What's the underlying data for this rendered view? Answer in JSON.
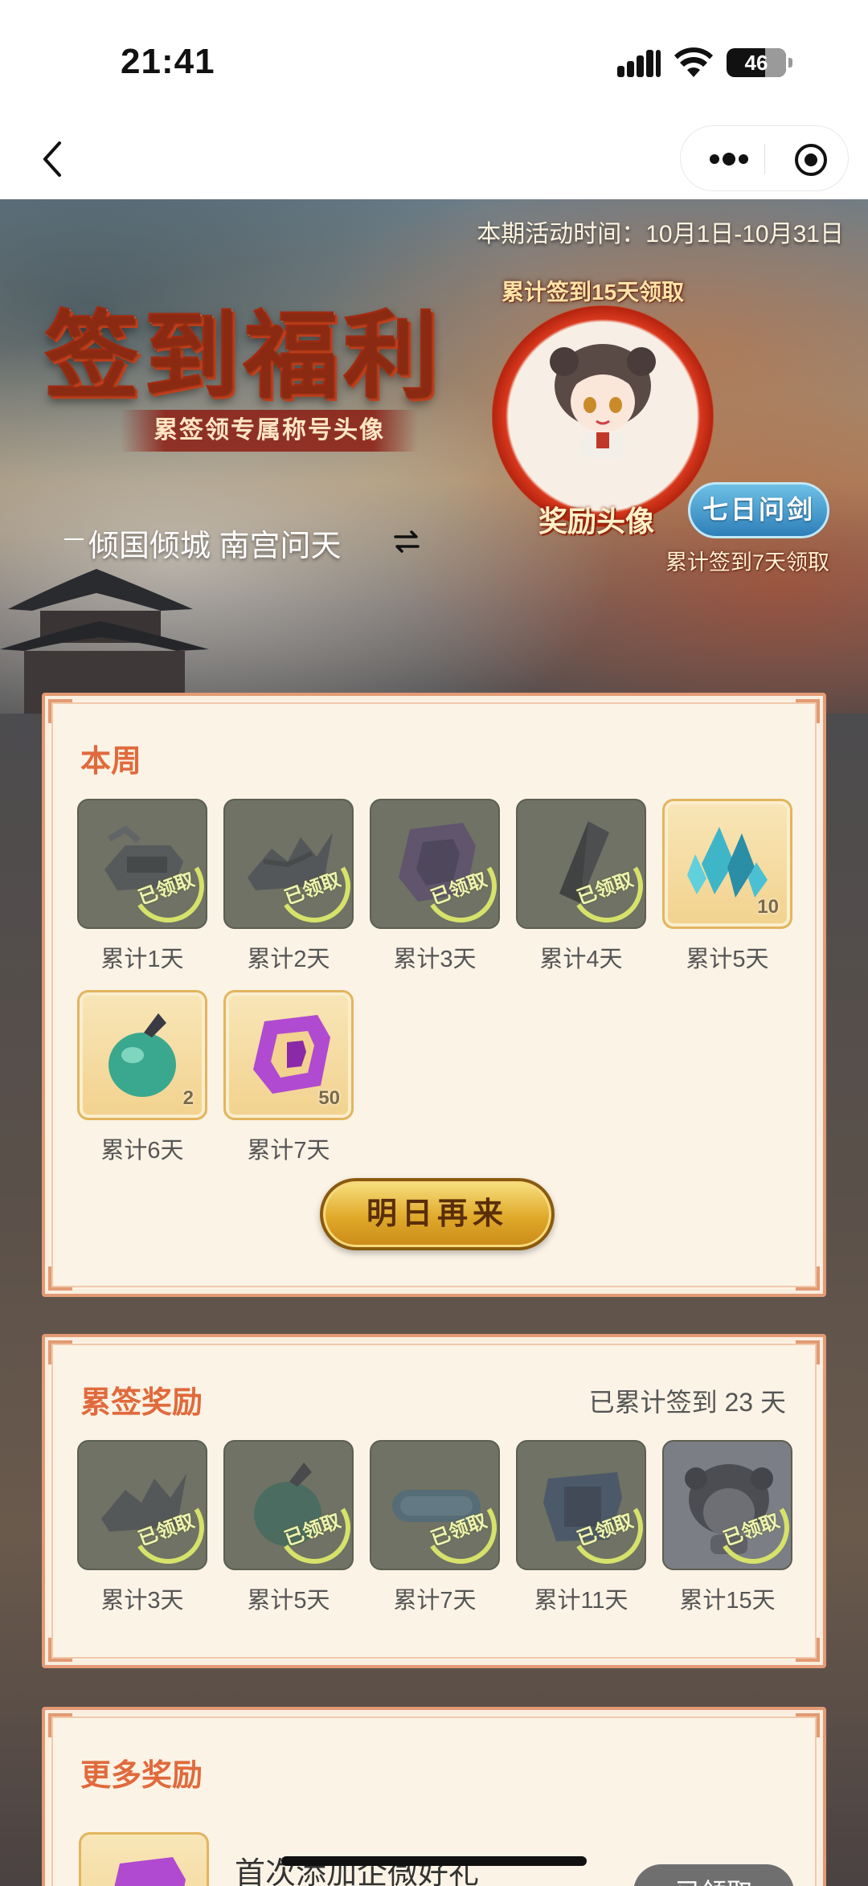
{
  "status_bar": {
    "time": "21:41",
    "battery": "46"
  },
  "nav": {
    "back": "back",
    "more": "more",
    "close": "close"
  },
  "hero": {
    "activity_time": "本期活动时间：10月1日-10月31日",
    "title": "签到福利",
    "subtitle": "累签领专属称号头像",
    "name": "倾国倾城 南宫问天",
    "avatar_caption": "累计签到15天领取",
    "avatar_label": "奖励头像",
    "title_badge": "七日问剑",
    "title_caption": "累计签到7天领取"
  },
  "week": {
    "title": "本周",
    "items": [
      {
        "label": "累计1天",
        "state": "claimed",
        "stamp": "已领取",
        "icon": "bronze-device-icon"
      },
      {
        "label": "累计2天",
        "state": "claimed",
        "stamp": "已领取",
        "icon": "broken-wing-icon"
      },
      {
        "label": "累计3天",
        "state": "claimed",
        "stamp": "已领取",
        "icon": "purple-rune-icon"
      },
      {
        "label": "累计4天",
        "state": "claimed",
        "stamp": "已领取",
        "icon": "dark-blade-icon"
      },
      {
        "label": "累计5天",
        "state": "available",
        "count": "10",
        "icon": "blue-crystal-icon"
      },
      {
        "label": "累计6天",
        "state": "available",
        "count": "2",
        "icon": "jade-pouch-icon"
      },
      {
        "label": "累计7天",
        "state": "available",
        "count": "50",
        "icon": "purple-rune-icon"
      }
    ],
    "button": "明日再来"
  },
  "total": {
    "title": "累签奖励",
    "note": "已累计签到 23 天",
    "items": [
      {
        "label": "累计3天",
        "state": "claimed",
        "stamp": "已领取",
        "icon": "broken-wing-icon"
      },
      {
        "label": "累计5天",
        "state": "claimed",
        "stamp": "已领取",
        "icon": "jade-pouch-icon"
      },
      {
        "label": "累计7天",
        "state": "claimed",
        "stamp": "已领取",
        "icon": "title-badge-icon"
      },
      {
        "label": "累计11天",
        "state": "claimed",
        "stamp": "已领取",
        "icon": "armor-icon"
      },
      {
        "label": "累计15天",
        "state": "claimed",
        "stamp": "已领取",
        "icon": "avatar-icon"
      }
    ]
  },
  "more": {
    "title": "更多奖励",
    "item_title": "首次添加企微好礼",
    "item_button": "已领取"
  },
  "colors": {
    "accent": "#e06a3c",
    "panel_bg": "#fbf3e6",
    "panel_border": "#e39a74",
    "claimed_tile": "#6f7264"
  }
}
